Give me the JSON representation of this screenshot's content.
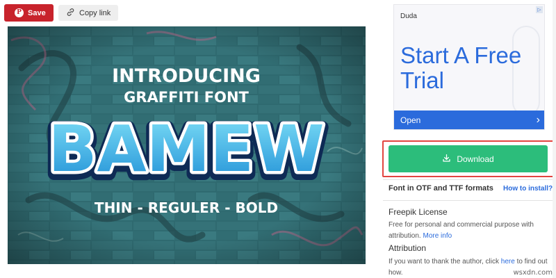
{
  "toolbar": {
    "save_label": "Save",
    "save_icon_glyph": "P",
    "copy_label": "Copy link"
  },
  "hero": {
    "line1": "INTRODUCING",
    "line2": "GRAFFITI FONT",
    "title": "BAMEW",
    "weights": "THIN - REGULER - BOLD"
  },
  "ad": {
    "brand": "Duda",
    "headline": "Start A Free Trial",
    "cta": "Open",
    "cta_arrow": "›",
    "badge": "▷"
  },
  "download": {
    "label": "Download",
    "accent": "#2cbd7b",
    "highlight": "#e3443f"
  },
  "formats": {
    "text": "Font in OTF and TTF formats",
    "howto": "How to install?"
  },
  "license": {
    "title": "Freepik License",
    "text": "Free for personal and commercial purpose with attribution.",
    "link": "More info"
  },
  "attribution": {
    "title": "Attribution",
    "text_before": "If you want to thank the author, click",
    "link": "here",
    "text_after": "to find out how."
  },
  "site_watermark": "wsxdn.com",
  "colors": {
    "save_red": "#c8232c",
    "link_blue": "#2b6bdc",
    "ad_blue": "#2b6bdc"
  }
}
